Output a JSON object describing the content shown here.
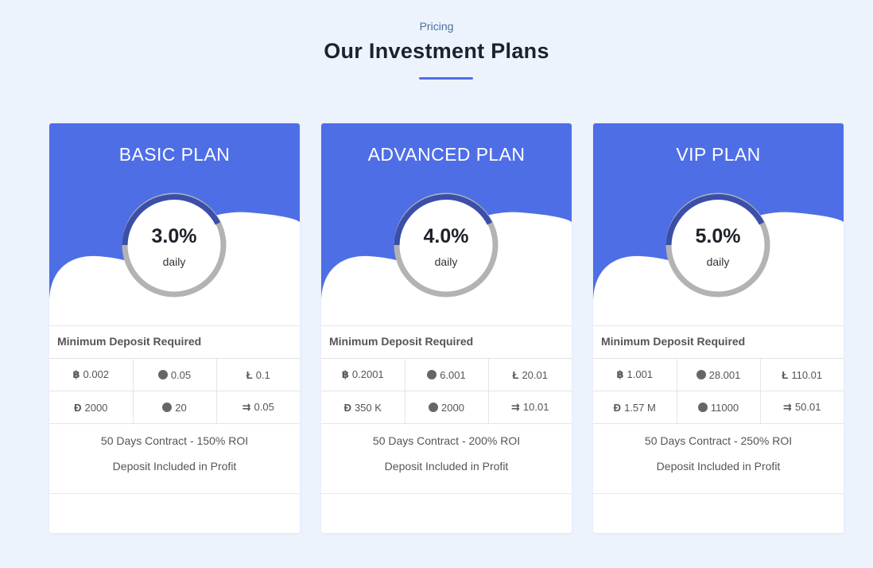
{
  "header": {
    "eyebrow": "Pricing",
    "title": "Our Investment Plans"
  },
  "colors": {
    "accent": "#4e6ee6",
    "ring_dark": "#3a4fa8",
    "ring_light": "#b3b3b3",
    "page_bg": "#edf3fd"
  },
  "min_deposit_label": "Minimum Deposit Required",
  "plans": [
    {
      "name": "BASIC PLAN",
      "rate": "3.0%",
      "rate_unit": "daily",
      "deposits": {
        "btc": "0.002",
        "eth": "0.05",
        "ltc": "0.1",
        "doge": "2000",
        "xrp": "20",
        "dash": "0.05"
      },
      "contract": "50 Days Contract - 150% ROI",
      "profit_note": "Deposit Included in Profit"
    },
    {
      "name": "ADVANCED PLAN",
      "rate": "4.0%",
      "rate_unit": "daily",
      "deposits": {
        "btc": "0.2001",
        "eth": "6.001",
        "ltc": "20.01",
        "doge": "350 K",
        "xrp": "2000",
        "dash": "10.01"
      },
      "contract": "50 Days Contract - 200% ROI",
      "profit_note": "Deposit Included in Profit"
    },
    {
      "name": "VIP PLAN",
      "rate": "5.0%",
      "rate_unit": "daily",
      "deposits": {
        "btc": "1.001",
        "eth": "28.001",
        "ltc": "110.01",
        "doge": "1.57 M",
        "xrp": "11000",
        "dash": "50.01"
      },
      "contract": "50 Days Contract - 250% ROI",
      "profit_note": "Deposit Included in Profit"
    }
  ]
}
